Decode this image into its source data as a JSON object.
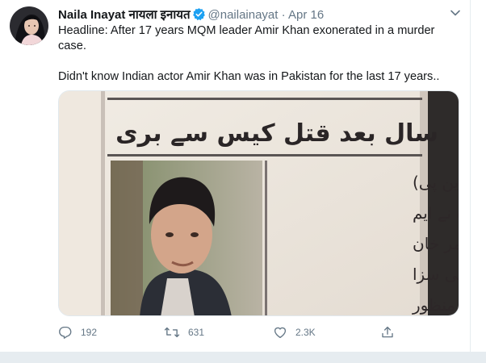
{
  "tweet": {
    "display_name": "Naila Inayat नायला इनायत",
    "handle": "@nailainayat",
    "separator": "·",
    "date": "Apr 16",
    "paragraphs": [
      "Headline: After 17 years MQM leader Amir Khan exonerated in a murder case.",
      "Didn't know Indian actor Amir Khan was in Pakistan for the last 17 years.."
    ],
    "media": {
      "urdu_headline": "سال بعد قتل کیس سے بری",
      "urdu_body_lines": [
        "کراچی (آئی این پی)",
        "سندھ ہائیکورٹ نے ایم",
        "کیو ایم رہنما عامر خان",
        "سمیت دو ملزمان کی سزا",
        "کے خلاف اپیل منظور"
      ]
    },
    "actions": {
      "reply_count": "192",
      "retweet_count": "631",
      "like_count": "2.3K"
    }
  },
  "colors": {
    "text_primary": "#14171a",
    "text_secondary": "#657786",
    "verified_blue": "#1da1f2",
    "divider": "#e6ecf0"
  }
}
